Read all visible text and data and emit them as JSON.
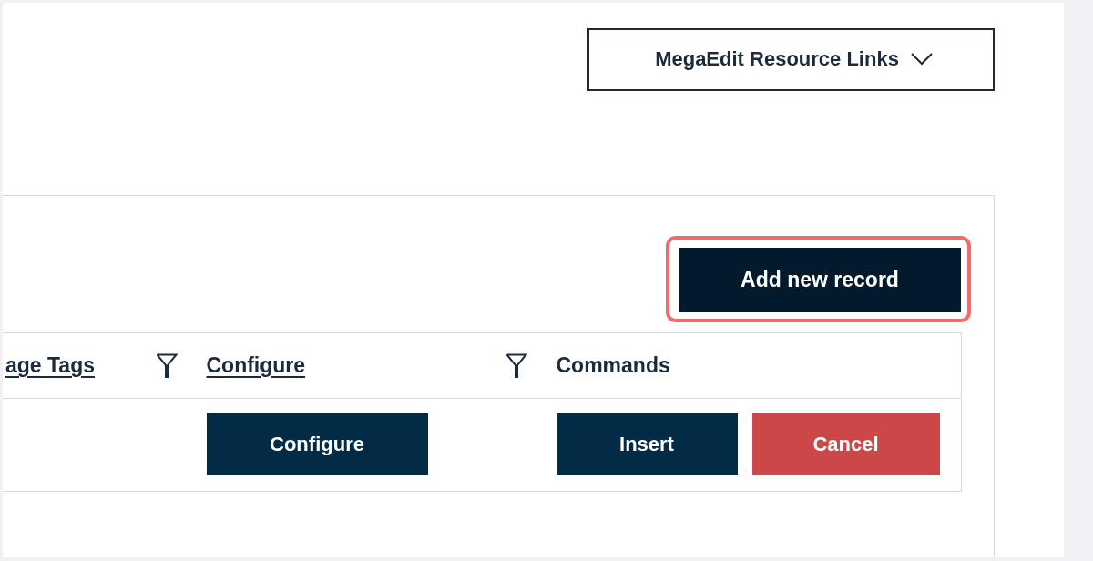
{
  "resource_links": {
    "label": "MegaEdit Resource Links"
  },
  "toolbar": {
    "add_button": {
      "label": "Add new record",
      "focused": true
    }
  },
  "table": {
    "columns": [
      {
        "label": "age Tags",
        "sortable": true,
        "filterable": true
      },
      {
        "label": "Configure",
        "sortable": true,
        "filterable": true
      },
      {
        "label": "Commands",
        "sortable": false,
        "filterable": false
      }
    ],
    "rows": [
      {
        "cells": [
          {
            "kind": "blank"
          },
          {
            "kind": "actions",
            "buttons": [
              {
                "label": "Configure",
                "kind": "primary"
              }
            ]
          },
          {
            "kind": "actions",
            "buttons": [
              {
                "label": "Insert",
                "kind": "primary"
              },
              {
                "label": "Cancel",
                "kind": "danger"
              }
            ]
          }
        ]
      }
    ]
  }
}
